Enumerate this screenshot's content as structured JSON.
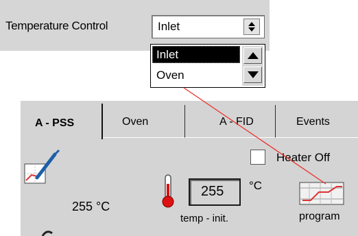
{
  "control": {
    "label": "Temperature Control",
    "selected": "Inlet",
    "options": [
      "Inlet",
      "Oven"
    ]
  },
  "tabs": [
    "A - PSS",
    "Oven",
    "A - FID",
    "Events"
  ],
  "panel": {
    "heater_label": "Heater Off",
    "temp_readout": "255 °C",
    "temp_value": "255",
    "temp_unit": "°C",
    "temp_label": "temp - init.",
    "program_label": "program"
  },
  "colors": {
    "connector": "#e8302a",
    "highlight": "#000000",
    "panel": "#d4d4d4"
  }
}
